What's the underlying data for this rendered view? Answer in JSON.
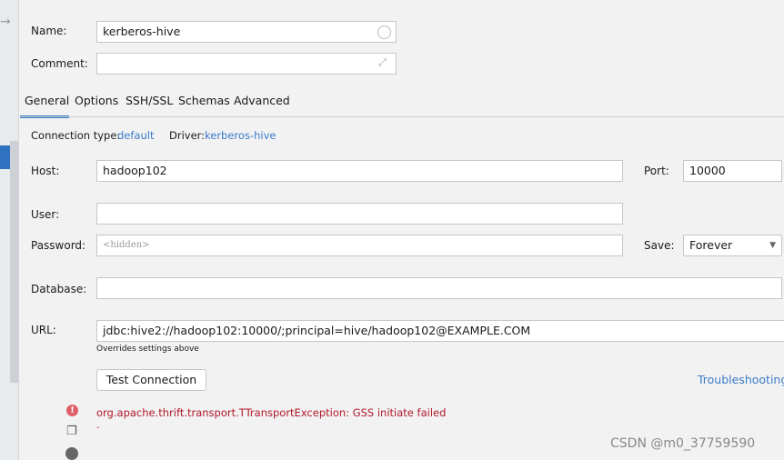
{
  "form": {
    "name_label": "Name:",
    "name_value": "kerberos-hive",
    "comment_label": "Comment:",
    "comment_value": ""
  },
  "tabs": [
    {
      "label": "General",
      "active": true
    },
    {
      "label": "Options"
    },
    {
      "label": "SSH/SSL"
    },
    {
      "label": "Schemas"
    },
    {
      "label": "Advanced"
    }
  ],
  "info": {
    "conn_type_label": "Connection type:",
    "conn_type_value": "default",
    "driver_label": "Driver:",
    "driver_value": "kerberos-hive"
  },
  "general": {
    "host_label": "Host:",
    "host_value": "hadoop102",
    "port_label": "Port:",
    "port_value": "10000",
    "user_label": "User:",
    "user_value": "",
    "password_label": "Password:",
    "password_placeholder": "<hidden>",
    "save_label": "Save:",
    "save_value": "Forever",
    "database_label": "Database:",
    "database_value": "",
    "url_label": "URL:",
    "url_value": "jdbc:hive2://hadoop102:10000/;principal=hive/hadoop102@EXAMPLE.COM",
    "url_hint": "Overrides settings above"
  },
  "actions": {
    "test_connection": "Test Connection",
    "troubleshooting": "Troubleshooting"
  },
  "error": {
    "message": "org.apache.thrift.transport.TTransportException: GSS initiate failed",
    "detail": "."
  },
  "watermark": "CSDN @m0_37759590",
  "colors": {
    "accent": "#3a7bc8",
    "error": "#b0182a",
    "error_icon": "#e0606a"
  }
}
